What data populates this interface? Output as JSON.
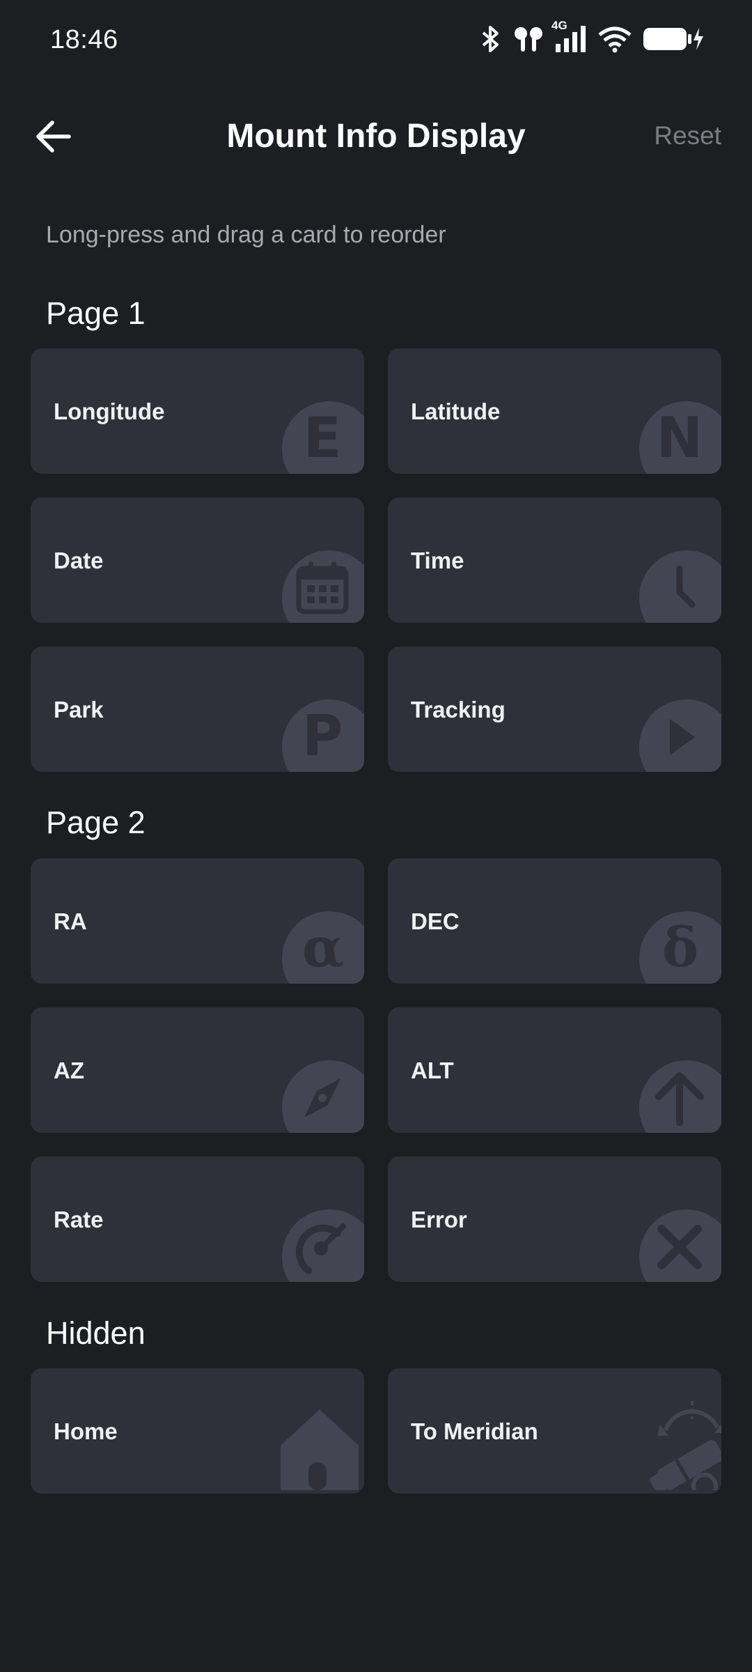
{
  "status_bar": {
    "time": "18:46",
    "icons": [
      "bluetooth-icon",
      "earbuds-icon",
      "cellular-4g-icon",
      "wifi-icon",
      "battery-charging-icon"
    ],
    "network_label": "4G"
  },
  "app_bar": {
    "back_icon": "arrow-left-icon",
    "title": "Mount Info Display",
    "reset_label": "Reset"
  },
  "hint": "Long-press and drag a card to reorder",
  "sections": [
    {
      "title": "Page 1",
      "cards": [
        {
          "label": "Longitude",
          "icon": "east-letter-icon",
          "glyph": "E"
        },
        {
          "label": "Latitude",
          "icon": "north-letter-icon",
          "glyph": "N"
        },
        {
          "label": "Date",
          "icon": "calendar-icon"
        },
        {
          "label": "Time",
          "icon": "clock-icon"
        },
        {
          "label": "Park",
          "icon": "park-letter-icon",
          "glyph": "P"
        },
        {
          "label": "Tracking",
          "icon": "play-icon"
        }
      ]
    },
    {
      "title": "Page 2",
      "cards": [
        {
          "label": "RA",
          "icon": "alpha-icon",
          "glyph": "α"
        },
        {
          "label": "DEC",
          "icon": "delta-icon",
          "glyph": "δ"
        },
        {
          "label": "AZ",
          "icon": "compass-icon"
        },
        {
          "label": "ALT",
          "icon": "arrow-up-icon"
        },
        {
          "label": "Rate",
          "icon": "gauge-icon"
        },
        {
          "label": "Error",
          "icon": "close-icon"
        }
      ]
    },
    {
      "title": "Hidden",
      "cards": [
        {
          "label": "Home",
          "icon": "home-icon"
        },
        {
          "label": "To Meridian",
          "icon": "telescope-flip-icon"
        }
      ]
    }
  ],
  "colors": {
    "background": "#1d1e22",
    "card": "#2f3039",
    "badge": "#434552",
    "hint_text": "#a9aab0",
    "reset_text": "#7c7d83"
  }
}
